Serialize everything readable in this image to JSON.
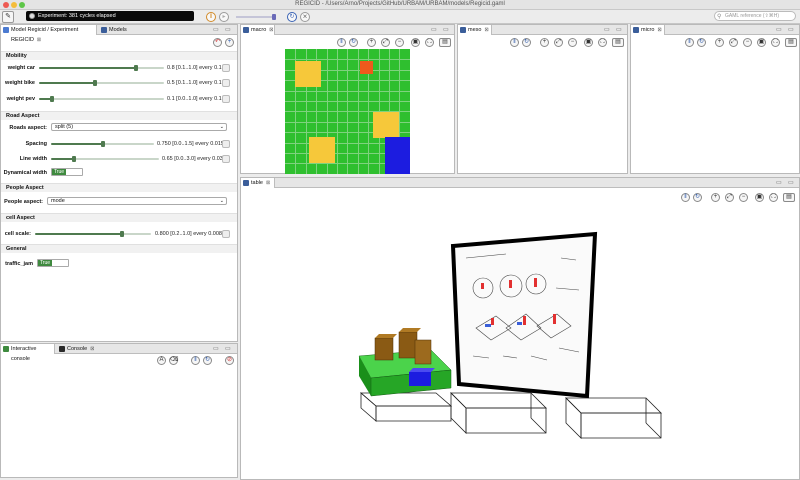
{
  "window": {
    "title": "REGICID - /Users/Arno/Projects/GitHub/URBAM/URBAM/models/Regicid.gaml"
  },
  "toolbar": {
    "status_text": "Experiment: 381 cycles elapsed",
    "search_placeholder": "GAML reference (⇧⌘H)"
  },
  "left_tabs": {
    "tab1": "Model Regicid / Experiment REGICID",
    "tab2": "Models"
  },
  "sections": {
    "mobility": "Mobility",
    "road": "Road Aspect",
    "people": "People Aspect",
    "cell": "cell Aspect",
    "general": "General"
  },
  "params": {
    "weight_car": {
      "label": "weight car",
      "value_text": "0.8 [0.1..1.0] every 0.1",
      "value": 0.8,
      "min": 0.1,
      "max": 1.0
    },
    "weight_bike": {
      "label": "weight bike",
      "value_text": "0.5 [0.1..1.0] every 0.1",
      "value": 0.5,
      "min": 0.1,
      "max": 1.0
    },
    "weight_pev": {
      "label": "weight pev",
      "value_text": "0.1 [0.0..1.0] every 0.1",
      "value": 0.1,
      "min": 0.0,
      "max": 1.0
    },
    "roads_aspect": {
      "label": "Roads aspect:",
      "value": "split (5)"
    },
    "spacing": {
      "label": "Spacing",
      "value_text": "0.750 [0.0..1.5] every 0.015",
      "value": 0.75,
      "min": 0.0,
      "max": 1.5
    },
    "line_width": {
      "label": "Line width",
      "value_text": "0.65 [0.0..3.0] every 0.03",
      "value": 0.65,
      "min": 0.0,
      "max": 3.0
    },
    "dynamical_width": {
      "label": "Dynamical width",
      "value": "True"
    },
    "people_aspect": {
      "label": "People aspect:",
      "value": "mode"
    },
    "cell_scale": {
      "label": "cell scale:",
      "value_text": "0.800 [0.2..1.0] every 0.008",
      "value": 0.8,
      "min": 0.2,
      "max": 1.0
    },
    "traffic_jam": {
      "label": "traffic_jam",
      "value": "True"
    }
  },
  "console_tabs": {
    "tab1": "Interactive console",
    "tab2": "Console"
  },
  "views": {
    "macro": "macro",
    "meso": "meso",
    "micro": "micro",
    "table": "table"
  },
  "colors": {
    "grid_green": "#2fbf2f",
    "yellow": "#f6c83a",
    "orange": "#ee5a1c",
    "blue": "#1c1ce0",
    "slider_green": "#4f7a4f"
  }
}
